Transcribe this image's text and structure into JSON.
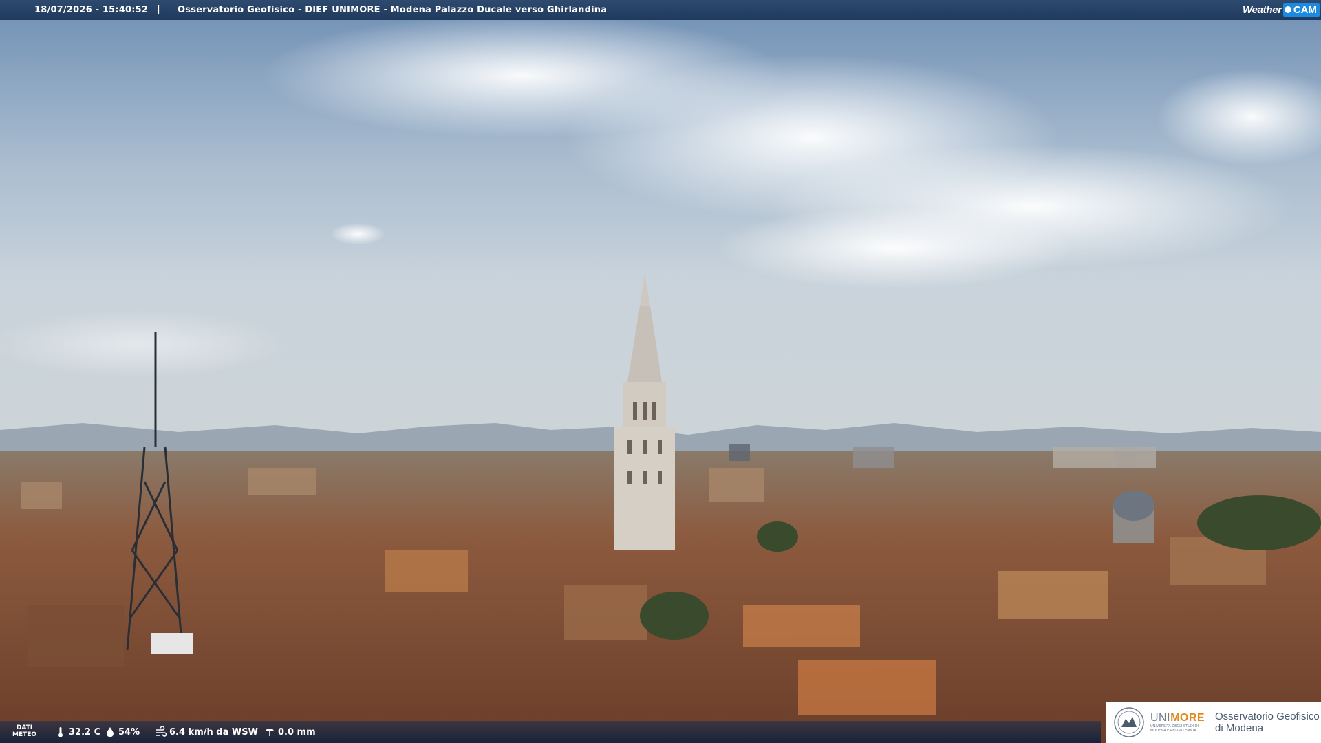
{
  "header": {
    "timestamp": "18/07/2026 - 15:40:52",
    "separator": "|",
    "caption": "Osservatorio Geofisico - DIEF UNIMORE - Modena Palazzo Ducale verso Ghirlandina",
    "brand_weather": "Weather",
    "brand_cam": "CAM"
  },
  "meteo": {
    "label_line1": "DATI",
    "label_line2": "METEO",
    "temperature": "32.2 C",
    "humidity": "54%",
    "wind": "6.4 km/h da WSW",
    "rain": "0.0 mm",
    "icons": [
      "thermometer-icon",
      "humidity-drop-icon",
      "wind-icon",
      "rain-gauge-icon"
    ]
  },
  "logo": {
    "uni_part1": "UNI",
    "uni_part2": "MORE",
    "uni_sub": "UNIVERSITÀ DEGLI STUDI DI MODENA E REGGIO EMILIA",
    "observatory_line1": "Osservatorio Geofisico",
    "observatory_line2": "di Modena"
  },
  "colors": {
    "bar": "#1f3a5c",
    "brand_cam": "#1a8be0",
    "unimore_accent": "#e08a1e"
  }
}
